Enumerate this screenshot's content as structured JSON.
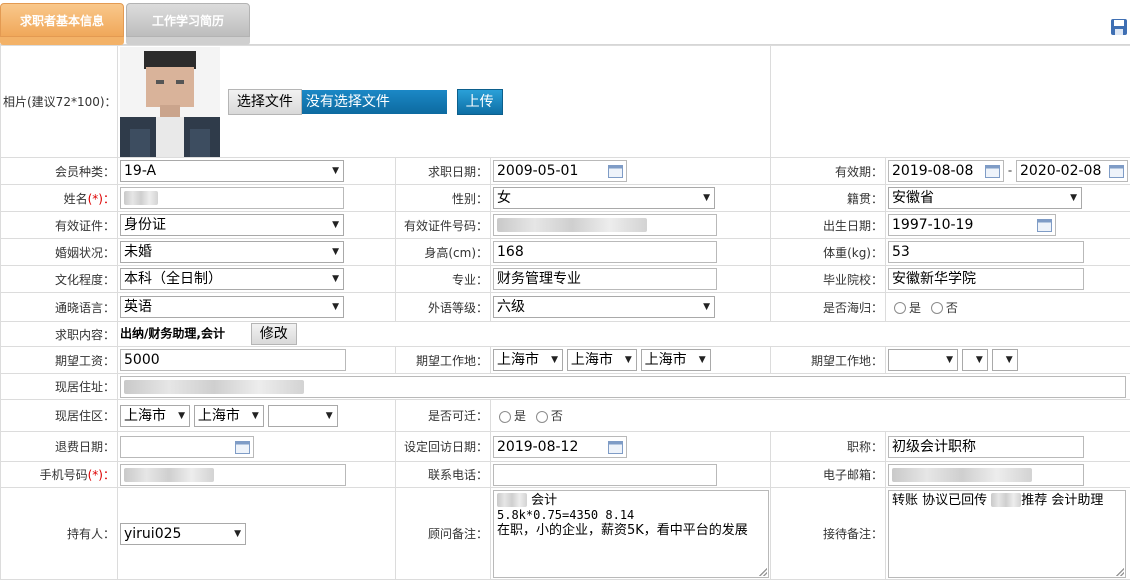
{
  "tabs": {
    "basic": "求职者基本信息",
    "history": "工作学习简历"
  },
  "photo": {
    "label": "相片(建议72*100)：",
    "choose_btn": "选择文件",
    "no_file": "没有选择文件",
    "upload_btn": "上传"
  },
  "labels": {
    "member_type": "会员种类：",
    "apply_date": "求职日期：",
    "valid_period": "有效期：",
    "name": "姓名",
    "gender": "性别：",
    "native": "籍贯：",
    "id_type": "有效证件：",
    "id_no": "有效证件号码：",
    "birth": "出生日期：",
    "marital": "婚姻状况：",
    "height": "身高(cm)：",
    "weight": "体重(kg)：",
    "education": "文化程度：",
    "major": "专业：",
    "school": "毕业院校：",
    "language": "通晓语言：",
    "lang_level": "外语等级：",
    "overseas": "是否海归：",
    "job_content": "求职内容：",
    "salary": "期望工资：",
    "work_place": "期望工作地：",
    "work_place2": "期望工作地：",
    "address": "现居住址：",
    "area": "现居住区：",
    "relocate": "是否可迁：",
    "refund_date": "退费日期：",
    "revisit_date": "设定回访日期：",
    "title": "职称：",
    "mobile": "手机号码",
    "phone": "联系电话：",
    "email": "电子邮箱：",
    "holder": "持有人：",
    "consultant_note": "顾问备注：",
    "reception_note": "接待备注：",
    "req_mark": "(*)：",
    "yes": "是",
    "no": "否",
    "sep": "-"
  },
  "values": {
    "member_type": "19-A",
    "apply_date": "2009-05-01",
    "valid_from": "2019-08-08",
    "valid_to": "2020-02-08",
    "gender": "女",
    "native": "安徽省",
    "id_type": "身份证",
    "birth": "1997-10-19",
    "marital": "未婚",
    "height": "168",
    "weight": "53",
    "education": "本科（全日制）",
    "major": "财务管理专业",
    "school": "安徽新华学院",
    "language": "英语",
    "lang_level": "六级",
    "job_content": "出纳/财务助理,会计",
    "modify_btn": "修改",
    "salary": "5000",
    "city1": "上海市",
    "city2": "上海市",
    "city3": "上海市",
    "area1": "上海市",
    "area2": "上海市",
    "revisit_date": "2019-08-12",
    "title": "初级会计职称",
    "holder": "yirui025",
    "consultant_note_1": "会计",
    "consultant_note_2": "5.8k*0.75=4350  8.14",
    "consultant_note_3": "在职，小的企业，薪资5K，看中平台的发展",
    "reception_note_a": "转账 协议已回传",
    "reception_note_b": "推荐 会计助理"
  },
  "colors": {
    "active_tab": "#f0a85a",
    "inactive_tab": "#bdbdbd",
    "blue_btn": "#0e6fa5",
    "required": "#dd0000"
  }
}
